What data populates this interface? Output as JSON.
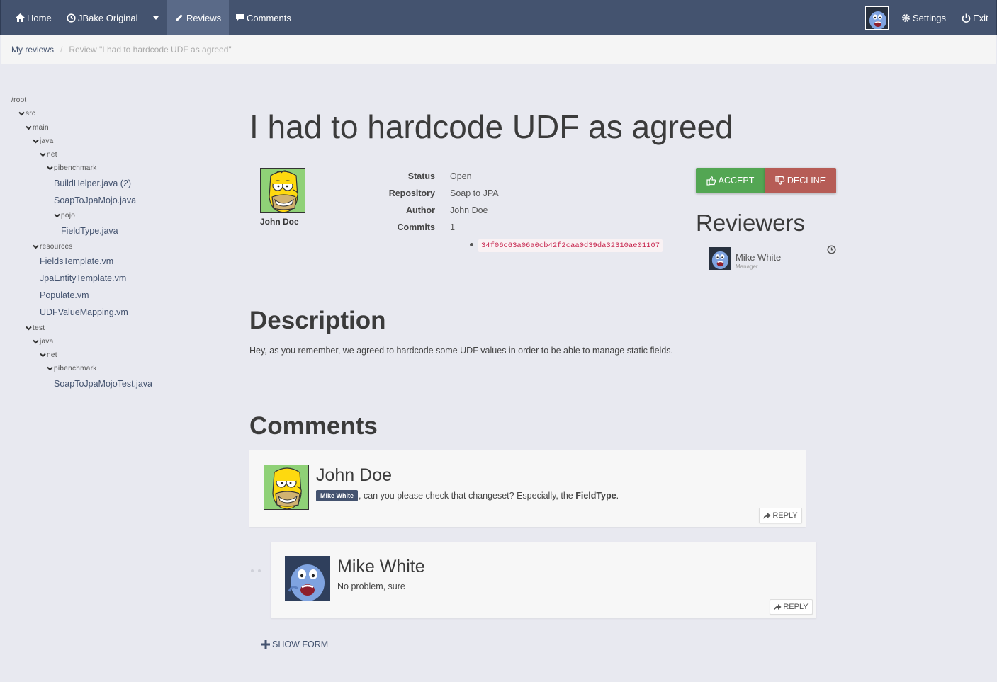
{
  "navbar": {
    "home": "Home",
    "project": "JBake Original",
    "reviews": "Reviews",
    "comments": "Comments",
    "settings": "Settings",
    "exit": "Exit"
  },
  "breadcrumb": {
    "parent": "My reviews",
    "separator": "/",
    "current": "Review \"I had to hardcode UDF as agreed\""
  },
  "tree": {
    "root": "/root",
    "nodes": [
      {
        "label": "src",
        "type": "dir"
      },
      {
        "label": "main",
        "type": "dir"
      },
      {
        "label": "java",
        "type": "dir"
      },
      {
        "label": "net",
        "type": "dir"
      },
      {
        "label": "pibenchmark",
        "type": "dir"
      },
      {
        "label": "BuildHelper.java (2)",
        "type": "file"
      },
      {
        "label": "SoapToJpaMojo.java",
        "type": "file"
      },
      {
        "label": "pojo",
        "type": "dir"
      },
      {
        "label": "FieldType.java",
        "type": "file"
      },
      {
        "label": "resources",
        "type": "dir"
      },
      {
        "label": "FieldsTemplate.vm",
        "type": "file"
      },
      {
        "label": "JpaEntityTemplate.vm",
        "type": "file"
      },
      {
        "label": "Populate.vm",
        "type": "file"
      },
      {
        "label": "UDFValueMapping.vm",
        "type": "file"
      },
      {
        "label": "test",
        "type": "dir"
      },
      {
        "label": "java",
        "type": "dir"
      },
      {
        "label": "net",
        "type": "dir"
      },
      {
        "label": "pibenchmark",
        "type": "dir"
      },
      {
        "label": "SoapToJpaMojoTest.java",
        "type": "file"
      }
    ]
  },
  "review": {
    "title": "I had to hardcode UDF as agreed",
    "author_name": "John Doe",
    "meta": {
      "status_label": "Status",
      "status": "Open",
      "repository_label": "Repository",
      "repository": "Soap to JPA",
      "author_label": "Author",
      "author": "John Doe",
      "commits_label": "Commits",
      "commits": "1",
      "commit_hash": "34f06c63a06a0cb42f2caa0d39da32310ae01107"
    },
    "accept_label": "ACCEPT",
    "decline_label": "DECLINE",
    "reviewers_title": "Reviewers",
    "reviewers": [
      {
        "name": "Mike White",
        "role": "Manager"
      }
    ],
    "description_title": "Description",
    "description": "Hey, as you remember, we agreed to hardcode some UDF values in order to be able to manage static fields."
  },
  "comments": {
    "title": "Comments",
    "items": [
      {
        "author": "John Doe",
        "mention": "Mike White",
        "text_before": ", can you please check that changeset? Especially, the ",
        "text_bold": "FieldType",
        "text_after": ".",
        "reply_label": "REPLY"
      },
      {
        "author": "Mike White",
        "text": "No problem, sure",
        "reply_label": "REPLY"
      }
    ],
    "show_form_label": "SHOW FORM"
  },
  "colors": {
    "navbar": "#44536f",
    "accept": "#53a653",
    "decline": "#b65c56",
    "hash_text": "#c7254e"
  }
}
